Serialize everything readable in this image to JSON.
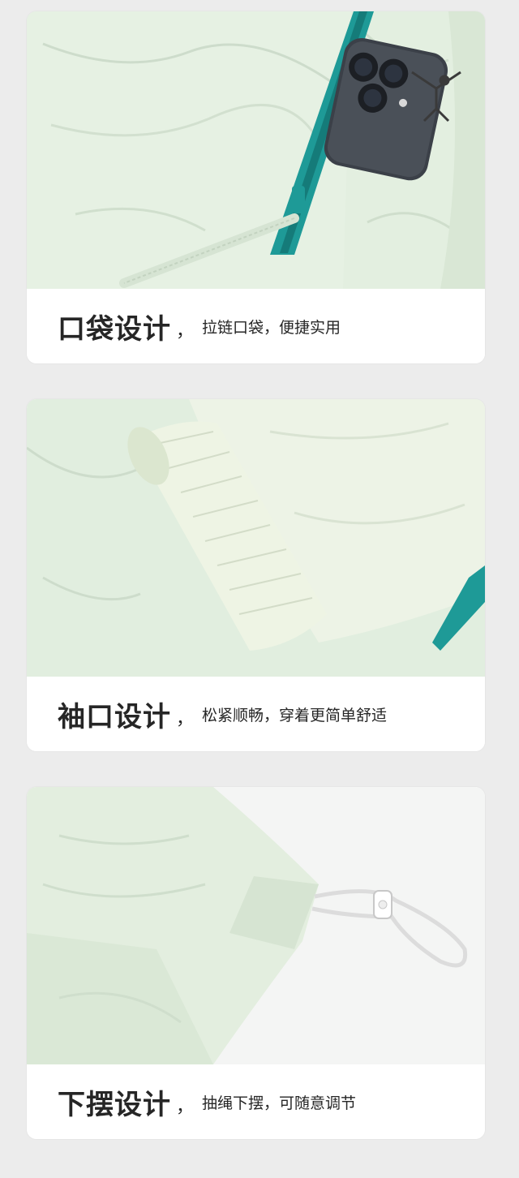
{
  "colors": {
    "fabric": "#e3efe0",
    "fabric_shadow": "#c9d8c6",
    "zipper_teal": "#1e9a97",
    "phone_dark": "#3b4048",
    "card_bg": "#ffffff",
    "page_bg": "#ececec",
    "text": "#262626"
  },
  "sections": [
    {
      "title": "口袋设计",
      "separator": "，",
      "description": "拉链口袋，便捷实用",
      "image_subject": "pocket-zipper-with-phone"
    },
    {
      "title": "袖口设计",
      "separator": "，",
      "description": "松紧顺畅，穿着更简单舒适",
      "image_subject": "elastic-cuff"
    },
    {
      "title": "下摆设计",
      "separator": "，",
      "description": "抽绳下摆，可随意调节",
      "image_subject": "drawstring-hem"
    }
  ]
}
